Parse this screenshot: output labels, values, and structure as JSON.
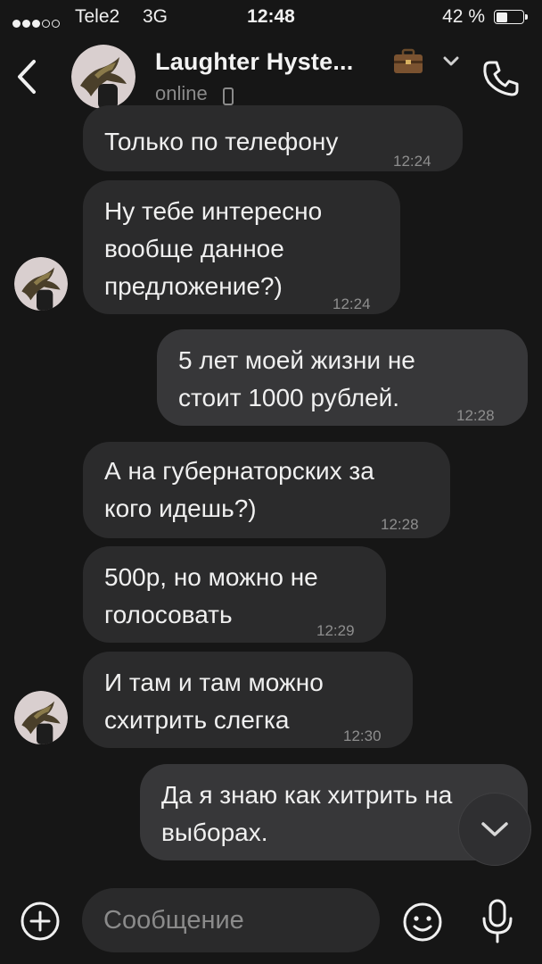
{
  "status_bar": {
    "carrier": "Tele2",
    "network": "3G",
    "time": "12:48",
    "battery_percent": "42 %",
    "battery_level": 0.42,
    "signal_bars_filled": 3,
    "signal_bars_total": 5
  },
  "header": {
    "contact_name": "Laughter Hyste...",
    "status": "online",
    "icons": [
      "back-icon",
      "avatar",
      "briefcase-icon",
      "chevron-down-icon",
      "device-icon",
      "phone-icon"
    ]
  },
  "messages": [
    {
      "direction": "in",
      "lines": [
        "Только по телефону"
      ],
      "time": "12:24",
      "avatar": false
    },
    {
      "direction": "in",
      "lines": [
        "Ну тебе интересно",
        "вообще данное",
        "предложение?)"
      ],
      "time": "12:24",
      "avatar": true
    },
    {
      "direction": "out",
      "lines": [
        "5 лет моей жизни не",
        "стоит 1000 рублей."
      ],
      "time": "12:28"
    },
    {
      "direction": "in",
      "lines": [
        "А на губернаторских за",
        "кого идешь?)"
      ],
      "time": "12:28",
      "avatar": false
    },
    {
      "direction": "in",
      "lines": [
        "500р, но можно не",
        "голосовать"
      ],
      "time": "12:29",
      "avatar": false
    },
    {
      "direction": "in",
      "lines": [
        "И там и там можно",
        "схитрить слегка"
      ],
      "time": "12:30",
      "avatar": true
    },
    {
      "direction": "out",
      "lines": [
        "Да я знаю как хитрить на",
        "выборах."
      ],
      "time": ""
    }
  ],
  "input_bar": {
    "placeholder": "Сообщение",
    "icons": [
      "plus-icon",
      "emoji-icon",
      "microphone-icon"
    ]
  },
  "scroll_down": {
    "icon": "chevron-down-icon"
  },
  "colors": {
    "background": "#161616",
    "incoming_bubble": "#2b2b2c",
    "outgoing_bubble": "#373739",
    "text": "#f0f0f0",
    "time_text": "#8e8e8e"
  }
}
